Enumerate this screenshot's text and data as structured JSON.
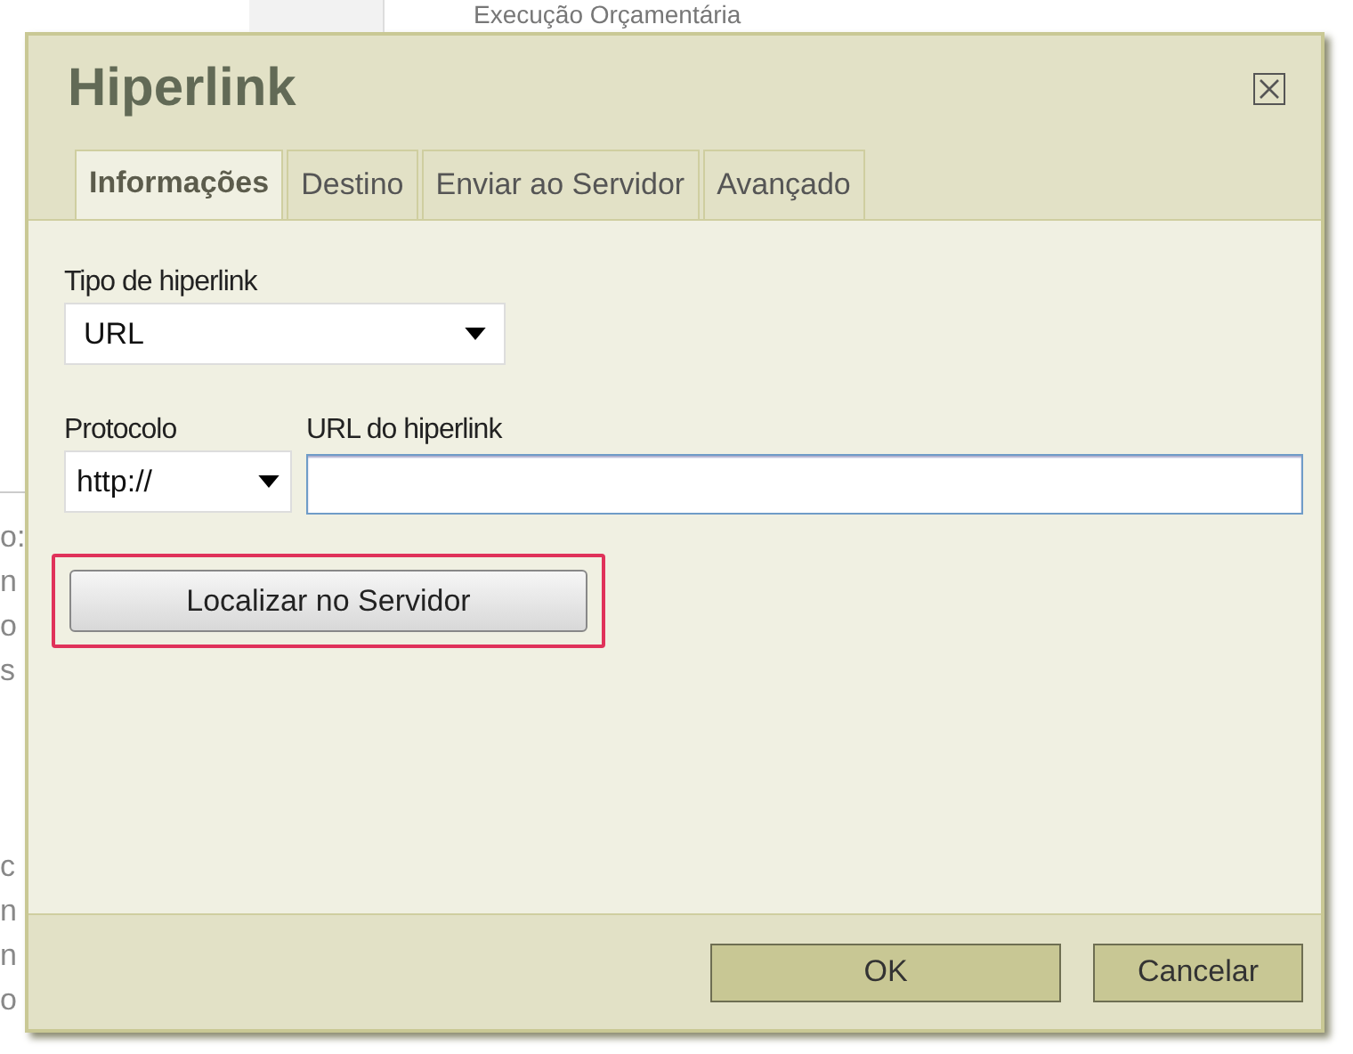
{
  "background_page": {
    "heading": "Execução Orçamentária",
    "left_fragments": [
      "o:",
      "n",
      "o",
      "s",
      "c",
      "n",
      "n",
      "o"
    ]
  },
  "dialog": {
    "title": "Hiperlink",
    "tabs": [
      {
        "label": "Informações",
        "selected": true
      },
      {
        "label": "Destino",
        "selected": false
      },
      {
        "label": "Enviar ao Servidor",
        "selected": false
      },
      {
        "label": "Avançado",
        "selected": false
      }
    ],
    "link_type": {
      "label": "Tipo de hiperlink",
      "value": "URL"
    },
    "protocol": {
      "label": "Protocolo",
      "value": "http://"
    },
    "url": {
      "label": "URL do hiperlink",
      "focused": true
    },
    "browse_button": {
      "label": "Localizar no Servidor",
      "highlighted": true
    },
    "buttons": [
      {
        "label": "OK",
        "kind": "primary"
      },
      {
        "label": "Cancelar",
        "kind": "secondary"
      }
    ]
  }
}
